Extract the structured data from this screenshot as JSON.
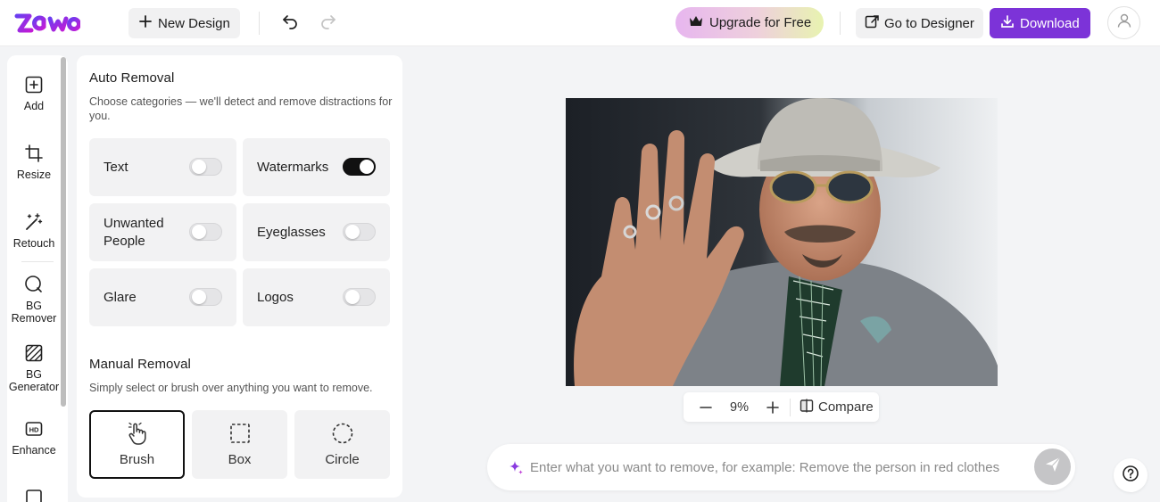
{
  "header": {
    "logo_text": "zawo",
    "new_design_label": "New Design",
    "upgrade_label": "Upgrade for Free",
    "go_to_designer_label": "Go to Designer",
    "download_label": "Download"
  },
  "rail": {
    "items": [
      {
        "label": "Add",
        "icon": "add-square-icon"
      },
      {
        "label": "Resize",
        "icon": "resize-icon"
      },
      {
        "label": "Retouch",
        "icon": "magic-wand-icon"
      },
      {
        "label": "BG Remover",
        "icon": "bg-remover-icon"
      },
      {
        "label": "BG Generator",
        "icon": "bg-generator-icon"
      },
      {
        "label": "Enhance",
        "icon": "hd-icon"
      }
    ]
  },
  "panel": {
    "auto_title": "Auto Removal",
    "auto_desc": "Choose categories — we'll detect and remove distractions for you.",
    "categories": [
      {
        "label": "Text",
        "enabled": false
      },
      {
        "label": "Watermarks",
        "enabled": true
      },
      {
        "label": "Unwanted People",
        "enabled": false
      },
      {
        "label": "Eyeglasses",
        "enabled": false
      },
      {
        "label": "Glare",
        "enabled": false
      },
      {
        "label": "Logos",
        "enabled": false
      }
    ],
    "manual_title": "Manual Removal",
    "manual_desc": "Simply select or brush over anything you want to remove.",
    "modes": [
      {
        "label": "Brush",
        "active": true,
        "icon": "hand-pointer-icon"
      },
      {
        "label": "Box",
        "active": false,
        "icon": "dashed-square-icon"
      },
      {
        "label": "Circle",
        "active": false,
        "icon": "dashed-circle-icon"
      }
    ]
  },
  "canvas": {
    "zoom": "9%",
    "compare_label": "Compare"
  },
  "prompt": {
    "placeholder": "Enter what you want to remove, for example: Remove the person in red clothes"
  },
  "colors": {
    "accent": "#7c33d8",
    "toggle_on": "#111111",
    "card_bg": "#f2f2f3"
  }
}
